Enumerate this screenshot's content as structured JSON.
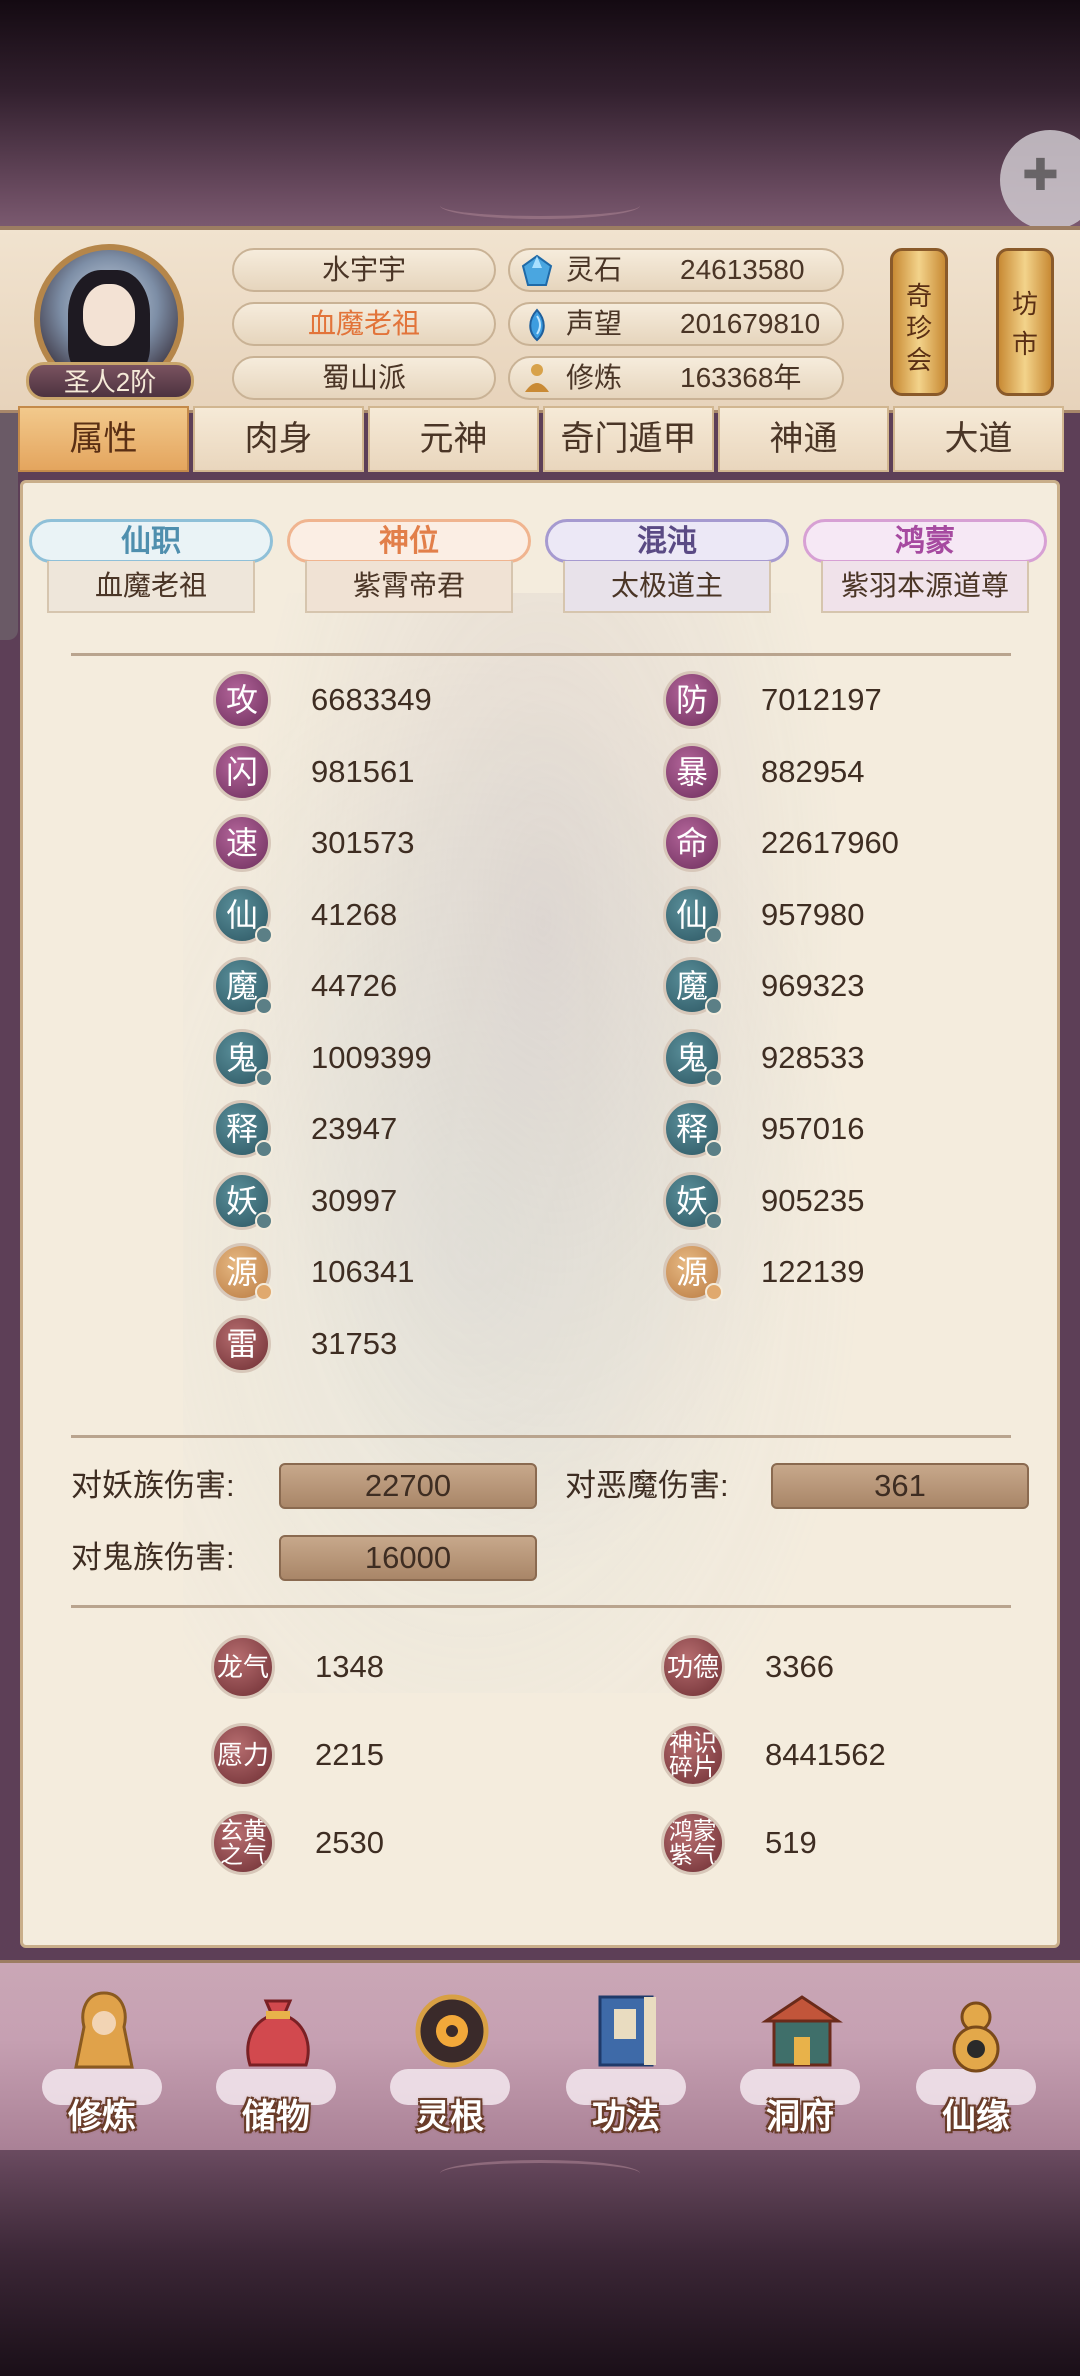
{
  "header": {
    "rank": "圣人2阶",
    "name": "水宇宇",
    "title": "血魔老祖",
    "sect": "蜀山派",
    "resources": [
      {
        "icon": "spirit-stone-icon",
        "label": "灵石",
        "value": "24613580"
      },
      {
        "icon": "prestige-icon",
        "label": "声望",
        "value": "201679810"
      },
      {
        "icon": "cultivation-icon",
        "label": "修炼",
        "value": "163368年"
      }
    ],
    "side_buttons": [
      {
        "label_lines": [
          "奇",
          "珍",
          "会"
        ]
      },
      {
        "label_lines": [
          "坊",
          "市"
        ]
      }
    ]
  },
  "tabs": [
    "属性",
    "肉身",
    "元神",
    "奇门遁甲",
    "神通",
    "大道"
  ],
  "active_tab": 0,
  "roles": [
    {
      "label": "仙职",
      "value": "血魔老祖",
      "color": "#4f8fae"
    },
    {
      "label": "神位",
      "value": "紫霄帝君",
      "color": "#e27f4a"
    },
    {
      "label": "混沌",
      "value": "太极道主",
      "color": "#5a4a84"
    },
    {
      "label": "鸿蒙",
      "value": "紫羽本源道尊",
      "color": "#a64aa0"
    }
  ],
  "stats_left": [
    {
      "glyph": "攻",
      "value": "6683349",
      "style": "purple",
      "badge": ""
    },
    {
      "glyph": "闪",
      "value": "981561",
      "style": "purple",
      "badge": ""
    },
    {
      "glyph": "速",
      "value": "301573",
      "style": "purple",
      "badge": ""
    },
    {
      "glyph": "仙",
      "value": "41268",
      "style": "teal",
      "badge": "teal"
    },
    {
      "glyph": "魔",
      "value": "44726",
      "style": "teal",
      "badge": "teal"
    },
    {
      "glyph": "鬼",
      "value": "1009399",
      "style": "teal",
      "badge": "teal"
    },
    {
      "glyph": "释",
      "value": "23947",
      "style": "teal",
      "badge": "teal"
    },
    {
      "glyph": "妖",
      "value": "30997",
      "style": "teal",
      "badge": "teal"
    },
    {
      "glyph": "源",
      "value": "106341",
      "style": "gold",
      "badge": "gold"
    },
    {
      "glyph": "雷",
      "value": "31753",
      "style": "red",
      "badge": ""
    }
  ],
  "stats_right": [
    {
      "glyph": "防",
      "value": "7012197",
      "style": "purple",
      "badge": ""
    },
    {
      "glyph": "暴",
      "value": "882954",
      "style": "purple",
      "badge": ""
    },
    {
      "glyph": "命",
      "value": "22617960",
      "style": "purple",
      "badge": ""
    },
    {
      "glyph": "仙",
      "value": "957980",
      "style": "teal",
      "badge": "teal"
    },
    {
      "glyph": "魔",
      "value": "969323",
      "style": "teal",
      "badge": "teal"
    },
    {
      "glyph": "鬼",
      "value": "928533",
      "style": "teal",
      "badge": "teal"
    },
    {
      "glyph": "释",
      "value": "957016",
      "style": "teal",
      "badge": "teal"
    },
    {
      "glyph": "妖",
      "value": "905235",
      "style": "teal",
      "badge": "teal"
    },
    {
      "glyph": "源",
      "value": "122139",
      "style": "gold",
      "badge": "gold"
    }
  ],
  "damage": [
    {
      "label": "对妖族伤害:",
      "value": "22700"
    },
    {
      "label": "对恶魔伤害:",
      "value": "361"
    },
    {
      "label": "对鬼族伤害:",
      "value": "16000"
    }
  ],
  "misc_left": [
    {
      "glyph": "龙气",
      "value": "1348"
    },
    {
      "glyph": "愿力",
      "value": "2215"
    },
    {
      "glyph": "玄黄之气",
      "value": "2530"
    }
  ],
  "misc_right": [
    {
      "glyph": "功德",
      "value": "3366"
    },
    {
      "glyph": "神识碎片",
      "value": "8441562"
    },
    {
      "glyph": "鸿蒙紫气",
      "value": "519"
    }
  ],
  "nav": [
    {
      "label": "修炼",
      "icon": "meditating-monk-icon"
    },
    {
      "label": "储物",
      "icon": "storage-bag-icon"
    },
    {
      "label": "灵根",
      "icon": "spirit-root-orb-icon"
    },
    {
      "label": "功法",
      "icon": "technique-book-icon"
    },
    {
      "label": "洞府",
      "icon": "cave-dwelling-icon"
    },
    {
      "label": "仙缘",
      "icon": "gourd-icon"
    }
  ]
}
